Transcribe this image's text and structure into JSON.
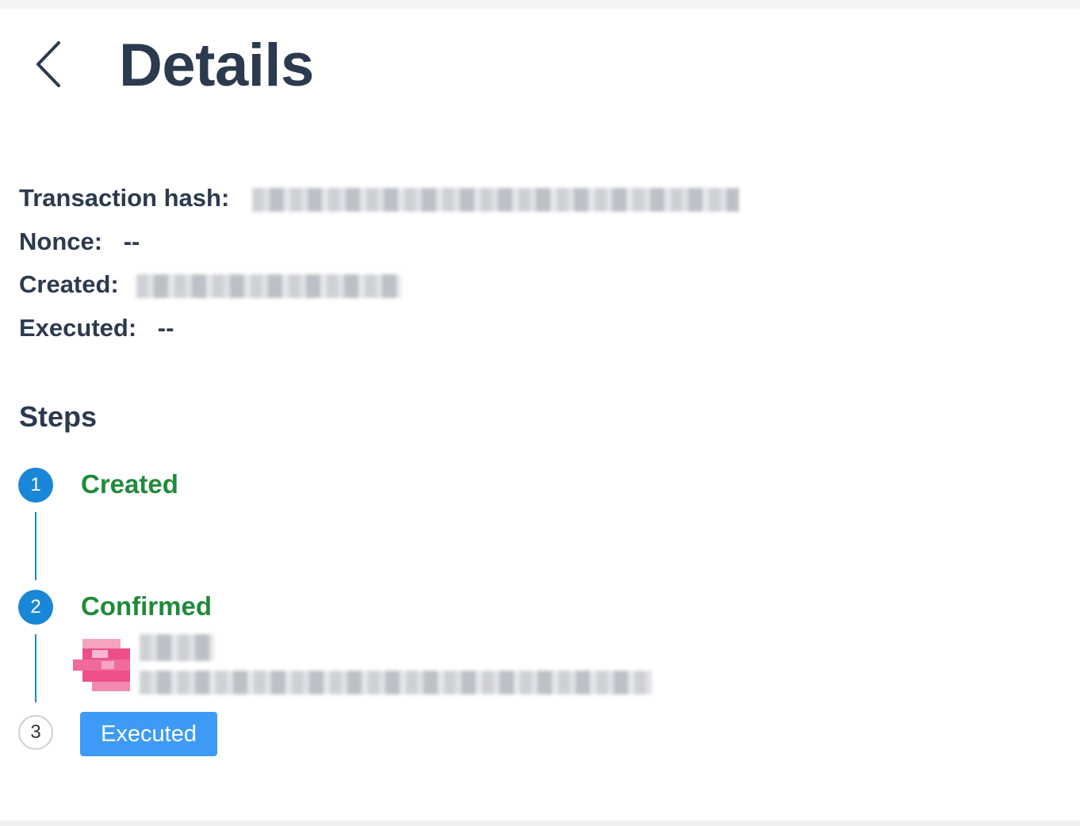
{
  "header": {
    "title": "Details",
    "back_icon": "chevron-left-icon"
  },
  "details": {
    "transaction_hash_label": "Transaction hash:",
    "nonce_label": "Nonce:",
    "nonce_value": "--",
    "created_label": "Created:",
    "executed_label": "Executed:",
    "executed_value": "--"
  },
  "steps": {
    "heading": "Steps",
    "items": [
      {
        "number": "1",
        "title": "Created"
      },
      {
        "number": "2",
        "title": "Confirmed"
      },
      {
        "number": "3",
        "title": "Executed"
      }
    ]
  },
  "colors": {
    "title_text": "#2b3a4e",
    "step_done": "#1a86d8",
    "step_title": "#1f8a3a",
    "button_bg": "#3d9bf5",
    "avatar_pink": "#ec4f8a"
  }
}
